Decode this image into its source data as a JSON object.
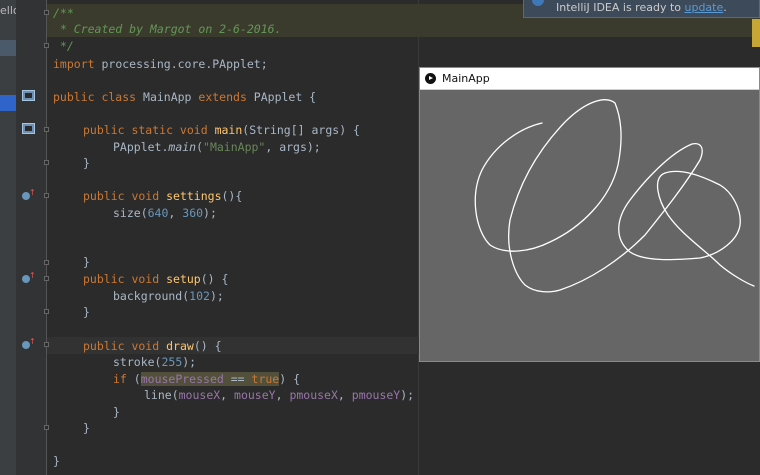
{
  "left_panel": {
    "cut_text": "ello"
  },
  "notification": {
    "text": "IntelliJ IDEA is ready to ",
    "link": "update",
    "end": "."
  },
  "code": {
    "c1": "/**",
    "c2": " * Created by Margot on 2-6-2016.",
    "c3": " */",
    "import_kw": "import",
    "import_path": " processing.core.PApplet;",
    "cls_kw": "public class",
    "cls_name": " MainApp ",
    "cls_ext": "extends",
    "cls_base": " PApplet {",
    "main_kw": "public static void",
    "main_fn": "main",
    "main_sig": "(String[] args) {",
    "pa": "PApplet.",
    "pa_main": "main",
    "pa_open": "(",
    "pa_str": "\"MainApp\"",
    "pa_rest": ", args);",
    "brace": "}",
    "settings_kw": "public void",
    "settings_fn": "settings",
    "settings_end": "(){",
    "size_fn": "size(",
    "size_a": "640",
    "size_sep": ", ",
    "size_b": "360",
    "size_end": ");",
    "setup_kw": "public void",
    "setup_fn": "setup",
    "setup_end": "() {",
    "bg_fn": "background(",
    "bg_v": "102",
    "bg_end": ");",
    "draw_kw": "public void",
    "draw_fn": "draw",
    "draw_end": "() {",
    "stroke_fn": "stroke(",
    "stroke_v": "255",
    "stroke_end": ");",
    "if_kw": "if",
    "if_open": " (",
    "if_var": "mousePressed",
    "if_op": " == ",
    "if_true": "true",
    "if_close": ") {",
    "line_fn": "line(",
    "line_a": "mouseX",
    "line_b": "mouseY",
    "line_c": "pmouseX",
    "line_d": "pmouseY",
    "line_end": ");"
  },
  "app_window": {
    "title": "MainApp"
  },
  "colors": {
    "keyword": "#cc7832",
    "function": "#ffc66d",
    "string": "#6a8759",
    "number": "#6897bb",
    "field": "#9876aa",
    "comment": "#629755"
  }
}
